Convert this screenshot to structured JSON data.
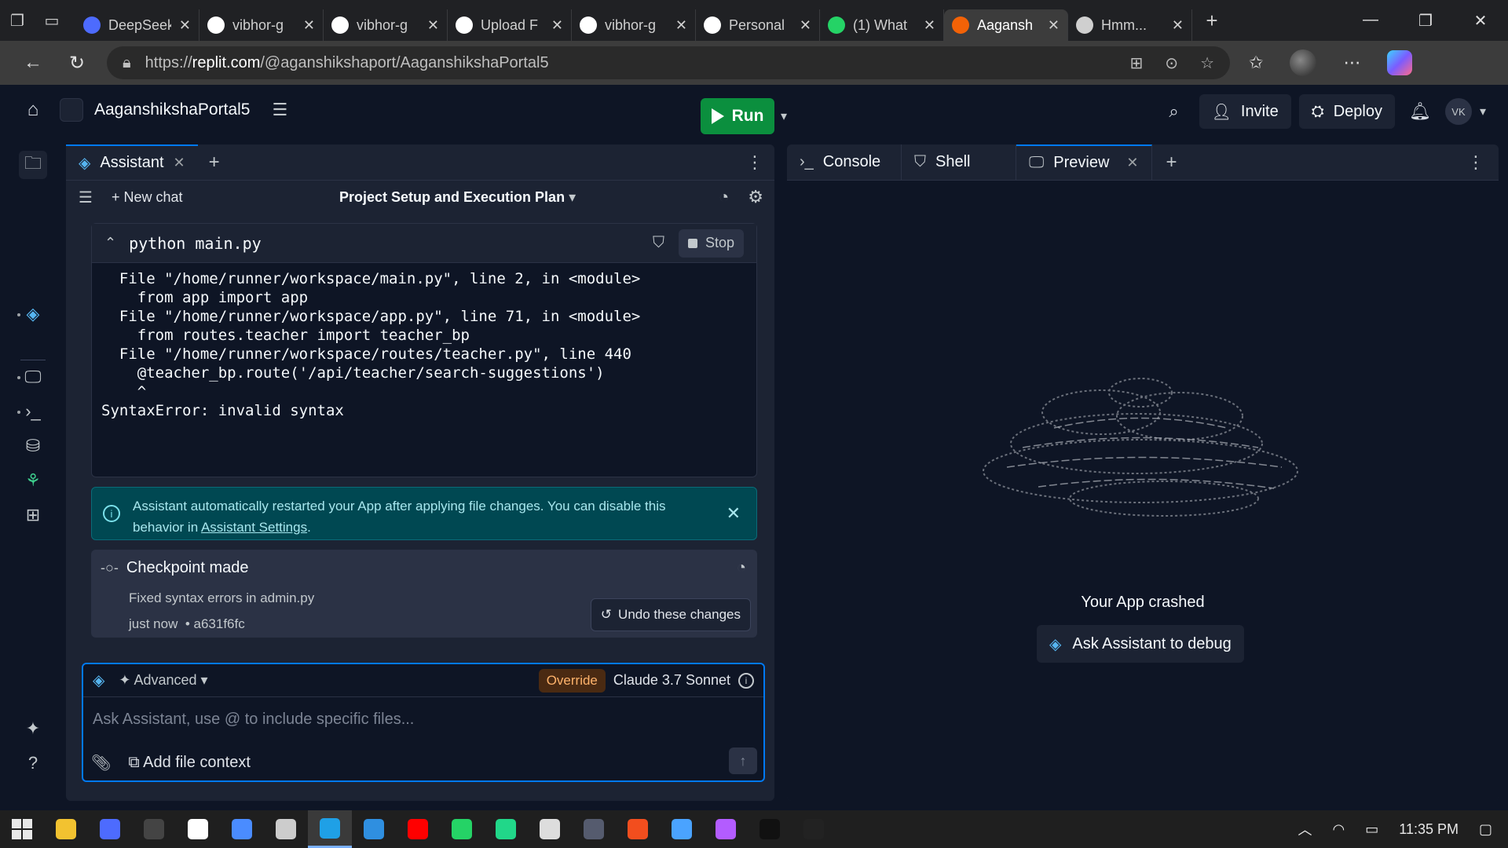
{
  "browser": {
    "tabs": [
      {
        "title": "DeepSeek",
        "icon": "deepseek-icon",
        "color": "#4d6bfe"
      },
      {
        "title": "vibhor-g",
        "icon": "github-icon",
        "color": "#ffffff"
      },
      {
        "title": "vibhor-g",
        "icon": "github-icon",
        "color": "#ffffff"
      },
      {
        "title": "Upload F",
        "icon": "openai-icon",
        "color": "#ffffff"
      },
      {
        "title": "vibhor-g",
        "icon": "github-icon",
        "color": "#ffffff"
      },
      {
        "title": "Personal",
        "icon": "github-icon",
        "color": "#ffffff"
      },
      {
        "title": "(1) What",
        "icon": "whatsapp-icon",
        "color": "#25d366"
      },
      {
        "title": "Aagansh",
        "icon": "replit-icon",
        "color": "#f26207"
      },
      {
        "title": "Hmm...",
        "icon": "globe-icon",
        "color": "#cfcfcf"
      }
    ],
    "url_prefix": "https://",
    "url_host": "replit.com",
    "url_path": "/@aganshikshaport/AaganshikshaPortal5"
  },
  "app": {
    "project_name": "AaganshikshaPortal5",
    "run_label": "Run",
    "invite_label": "Invite",
    "deploy_label": "Deploy",
    "user_initials": "VK"
  },
  "left_pane": {
    "tab_label": "Assistant",
    "new_chat_label": "New chat",
    "chat_title": "Project Setup and Execution Plan",
    "run_command": "python main.py",
    "stop_label": "Stop",
    "trace": "  File \"/home/runner/workspace/main.py\", line 2, in <module>\n    from app import app\n  File \"/home/runner/workspace/app.py\", line 71, in <module>\n    from routes.teacher import teacher_bp\n  File \"/home/runner/workspace/routes/teacher.py\", line 440\n    @teacher_bp.route('/api/teacher/search-suggestions')\n    ^\nSyntaxError: invalid syntax",
    "notice_text": "Assistant automatically restarted your App after applying file changes. You can disable this behavior in ",
    "notice_link": "Assistant Settings",
    "notice_end": ".",
    "checkpoint_title": "Checkpoint made",
    "checkpoint_desc": "Fixed syntax errors in admin.py",
    "checkpoint_time": "just now",
    "checkpoint_hash": "a631f6fc",
    "undo_label": "Undo these changes",
    "advanced_label": "Advanced",
    "override_label": "Override",
    "model_label": "Claude 3.7 Sonnet",
    "input_placeholder": "Ask Assistant, use @ to include specific files...",
    "add_file_context_label": "Add file context"
  },
  "right_pane": {
    "tabs": [
      "Console",
      "Shell",
      "Preview"
    ],
    "crash_text": "Your App crashed",
    "debug_label": "Ask Assistant to debug"
  },
  "taskbar": {
    "time": "11:35 PM",
    "apps": [
      {
        "name": "file-explorer-icon",
        "color": "#f2c230"
      },
      {
        "name": "deepseek-taskbar-icon",
        "color": "#4d6bfe"
      },
      {
        "name": "obs-icon",
        "color": "#444444"
      },
      {
        "name": "chatgpt-taskbar-icon",
        "color": "#ffffff"
      },
      {
        "name": "gemini-icon",
        "color": "#4a8cff"
      },
      {
        "name": "perplexity-icon",
        "color": "#cccccc"
      },
      {
        "name": "edge-icon",
        "color": "#1fa0e6"
      },
      {
        "name": "vscode-icon",
        "color": "#2f8fe0"
      },
      {
        "name": "youtube-icon",
        "color": "#ff0000"
      },
      {
        "name": "whatsapp-taskbar-icon",
        "color": "#25d366"
      },
      {
        "name": "pycharm-icon",
        "color": "#21d789"
      },
      {
        "name": "cube-app-icon",
        "color": "#dddddd"
      },
      {
        "name": "terminal-app-icon",
        "color": "#555b6e"
      },
      {
        "name": "figma-icon",
        "color": "#f24e1e"
      },
      {
        "name": "desktop-app-icon",
        "color": "#4aa3ff"
      },
      {
        "name": "copilot-taskbar-icon",
        "color": "#b35cff"
      },
      {
        "name": "dark-app-icon",
        "color": "#111111"
      },
      {
        "name": "cmd-icon",
        "color": "#222222"
      }
    ]
  }
}
